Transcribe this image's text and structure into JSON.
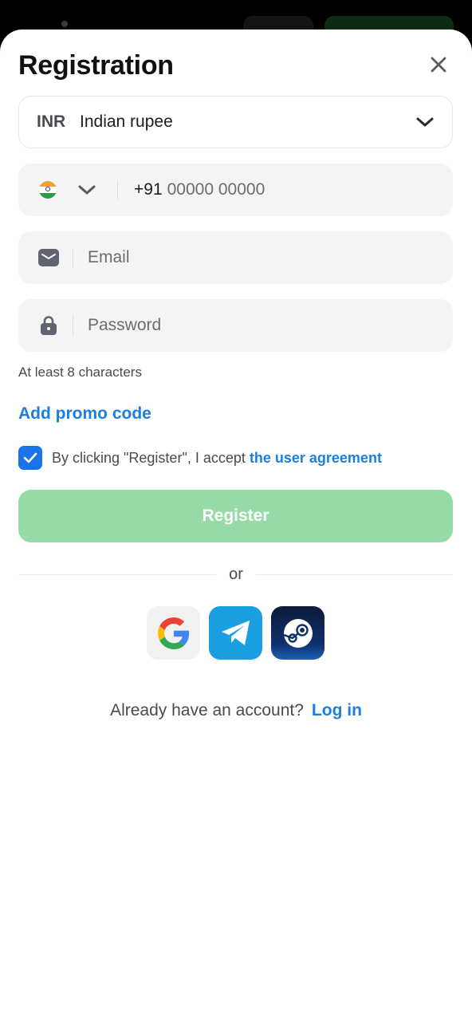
{
  "header": {
    "title": "Registration"
  },
  "currency": {
    "code": "INR",
    "name": "Indian rupee"
  },
  "phone": {
    "prefix": "+91",
    "placeholder": "00000 00000"
  },
  "email": {
    "placeholder": "Email"
  },
  "password": {
    "placeholder": "Password",
    "hint": "At least 8 characters"
  },
  "promo": {
    "label": "Add promo code"
  },
  "agreement": {
    "text": "By clicking \"Register\", I accept",
    "link": "the user agreement",
    "checked": true
  },
  "register": {
    "label": "Register"
  },
  "divider": {
    "label": "or"
  },
  "social": [
    {
      "icon": "google-icon"
    },
    {
      "icon": "telegram-icon"
    },
    {
      "icon": "steam-icon"
    }
  ],
  "login": {
    "question": "Already have an account?",
    "link": "Log in"
  },
  "colors": {
    "accent": "#1a7fe0",
    "register_disabled": "#98d9a8",
    "checkbox": "#1a73e8",
    "telegram": "#1a9fe2"
  }
}
